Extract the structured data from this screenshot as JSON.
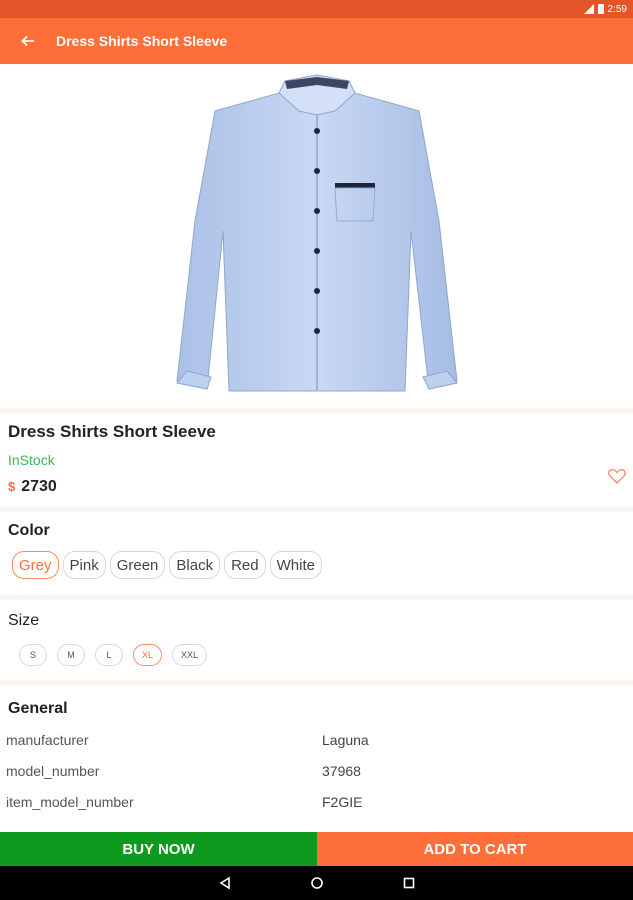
{
  "status_bar": {
    "time": "2:59",
    "icons": [
      "signal-icon",
      "battery-icon"
    ]
  },
  "app_bar": {
    "title": "Dress Shirts Short Sleeve",
    "back_icon": "arrow-back-icon"
  },
  "colors": {
    "accent": "#fd6e38",
    "status_bar": "#e4552a",
    "in_stock": "#33bb55",
    "buy_now": "#0e9a1e"
  },
  "product": {
    "name": "Dress Shirts Short Sleeve",
    "stock": "InStock",
    "currency": "$",
    "price": "2730",
    "favorite_icon": "heart-outline-icon"
  },
  "color_section": {
    "label": "Color",
    "options": [
      "Grey",
      "Pink",
      "Green",
      "Black",
      "Red",
      "White"
    ],
    "selected": "Grey"
  },
  "size_section": {
    "label": "Size",
    "options": [
      "S",
      "M",
      "L",
      "XL",
      "XXL"
    ],
    "selected": "XL"
  },
  "general": {
    "label": "General",
    "specs": [
      {
        "key": "manufacturer",
        "value": "Laguna"
      },
      {
        "key": "model_number",
        "value": "37968"
      },
      {
        "key": "item_model_number",
        "value": "F2GIE"
      }
    ]
  },
  "actions": {
    "buy_now": "BUY NOW",
    "add_to_cart": "ADD TO CART"
  },
  "nav": {
    "icons": [
      "back-triangle-icon",
      "home-circle-icon",
      "recents-square-icon"
    ]
  }
}
